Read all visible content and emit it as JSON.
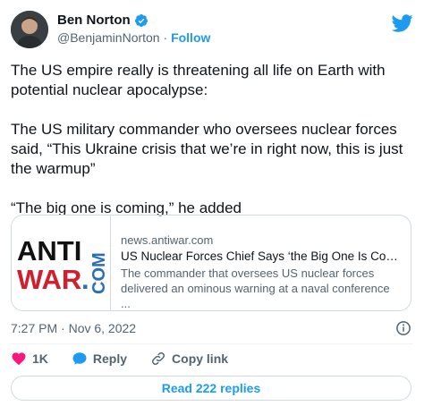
{
  "author": {
    "display_name": "Ben Norton",
    "handle": "@BenjaminNorton",
    "separator": "·",
    "follow_label": "Follow"
  },
  "tweet": {
    "text": "The US empire really is threatening all life on Earth with potential nuclear apocalypse:\n\nThe US military commander who oversees nuclear forces said, “This Ukraine crisis that we’re in right now, this is just the warmup”\n\n“The big one is coming,” he added"
  },
  "card": {
    "logo_line1": "ANTI",
    "logo_line2": "WAR",
    "logo_dot": ".",
    "logo_vertical": "COM",
    "domain": "news.antiwar.com",
    "title": "US Nuclear Forces Chief Says ‘the Big One Is Comin...",
    "description": "The commander that oversees US nuclear forces delivered an ominous warning at a naval conference ..."
  },
  "meta": {
    "timestamp": "7:27 PM · Nov 6, 2022"
  },
  "actions": {
    "like_count": "1K",
    "reply_label": "Reply",
    "copy_label": "Copy link"
  },
  "read_replies_label": "Read 222 replies",
  "colors": {
    "accent": "#1d9bf0",
    "like": "#f91880",
    "logo_red": "#d0202e",
    "logo_blue": "#2a6fb5"
  },
  "icons": [
    "verified-badge-icon",
    "twitter-bird-icon",
    "info-icon",
    "heart-icon",
    "reply-bubble-icon",
    "link-icon"
  ]
}
